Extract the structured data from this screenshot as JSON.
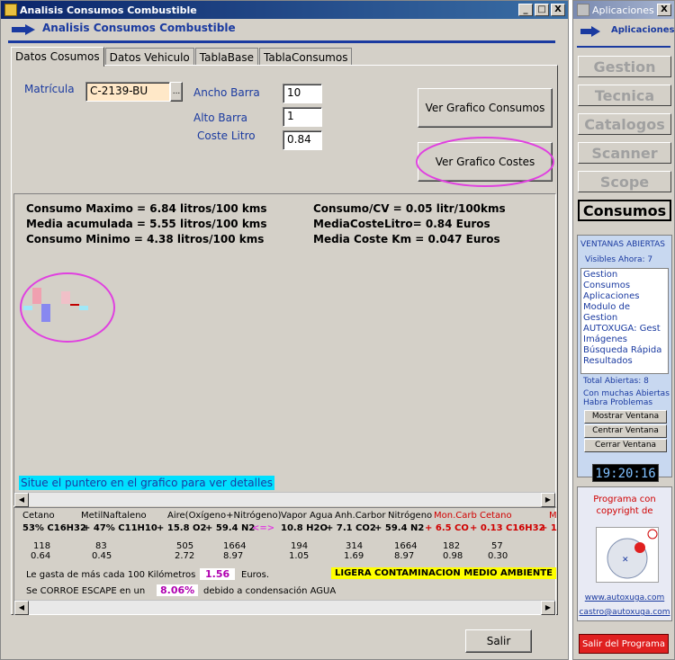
{
  "window": {
    "title": "Analisis Consumos Combustible",
    "header_title": "Analisis Consumos Combustible",
    "min": "_",
    "max": "□",
    "close": "X"
  },
  "tabs": [
    "Datos Cosumos",
    "Datos Vehiculo",
    "TablaBase",
    "TablaConsumos"
  ],
  "form": {
    "matricula_label": "Matrícula",
    "matricula_value": "C-2139-BU",
    "ancho_label": "Ancho Barra",
    "ancho_value": "10",
    "alto_label": "Alto Barra",
    "alto_value": "1",
    "coste_label": "Coste Litro",
    "coste_value": "0.84",
    "btn_consumos": "Ver Grafico Consumos",
    "btn_costes": "Ver Grafico Costes",
    "dots": "..."
  },
  "stats": {
    "l1": "Consumo Maximo = 6.84 litros/100 kms",
    "l2": "Media acumulada = 5.55 litros/100 kms",
    "l3": "Consumo Minimo  = 4.38 litros/100 kms",
    "r1": "Consumo/CV = 0.05 litr/100kms",
    "r2": "MediaCosteLitro= 0.84 Euros",
    "r3": "Media Coste Km = 0.047 Euros"
  },
  "hint": "Situe el puntero en el grafico para ver detalles",
  "chem": {
    "h_cetano": "Cetano",
    "h_metil": "MetilNaftaleno",
    "h_aire": "Aire(Oxígeno+Nitrógeno)",
    "h_vapor": "Vapor Agua",
    "h_anh": "Anh.Carbor",
    "h_nitro": "Nitrógeno",
    "h_mon": "Mon.Carb",
    "h_cet2": "Cetano",
    "h_m": "M",
    "eq": [
      "53% C16H32",
      "+ 47% C11H10",
      "+ 15.8 O2",
      "+ 59.4 N2",
      "<=>",
      "10.8 H2O",
      "+ 7.1 CO2",
      "+ 59.4 N2",
      "+ 6.5 CO",
      "+ 0.13 C16H32",
      "+ 1"
    ],
    "row1": [
      "118",
      "83",
      "505",
      "1664",
      "194",
      "314",
      "1664",
      "182",
      "57"
    ],
    "row2": [
      "0.64",
      "0.45",
      "2.72",
      "8.97",
      "1.05",
      "1.69",
      "8.97",
      "0.98",
      "0.30"
    ],
    "gasta_pre": "Le gasta de más cada 100 Kilómetros",
    "gasta_val": "1.56",
    "gasta_post": "Euros.",
    "contam": "LIGERA CONTAMINACION MEDIO AMBIENTE",
    "corroe_pre": "Se CORROE ESCAPE en un",
    "corroe_val": "8.06%",
    "corroe_post": "debido a condensación AGUA"
  },
  "salir": "Salir",
  "side": {
    "title": "Aplicaciones",
    "close": "X",
    "apps": "Aplicaciones",
    "nav": [
      "Gestion",
      "Tecnica",
      "Catalogos",
      "Scanner",
      "Scope",
      "Consumos"
    ],
    "vent_title": "VENTANAS ABIERTAS",
    "visibles": "Visibles Ahora: 7",
    "list": [
      "Gestion Consumos",
      "Aplicaciones",
      "Modulo de Gestion",
      "AUTOXUGA:  Gest",
      "Imágenes",
      "Búsqueda Rápida",
      "Resultados"
    ],
    "total": "Total Abiertas: 8",
    "warn1": "Con muchas Abiertas",
    "warn2": "Habra Problemas",
    "b1": "Mostrar Ventana",
    "b2": "Centrar Ventana",
    "b3": "Cerrar Ventana",
    "clock": "19:20:16",
    "prog1": "Programa con",
    "prog2": "copyright de",
    "url": "www.autoxuga.com",
    "mail": "castro@autoxuga.com",
    "exit": "Salir del Programa"
  }
}
